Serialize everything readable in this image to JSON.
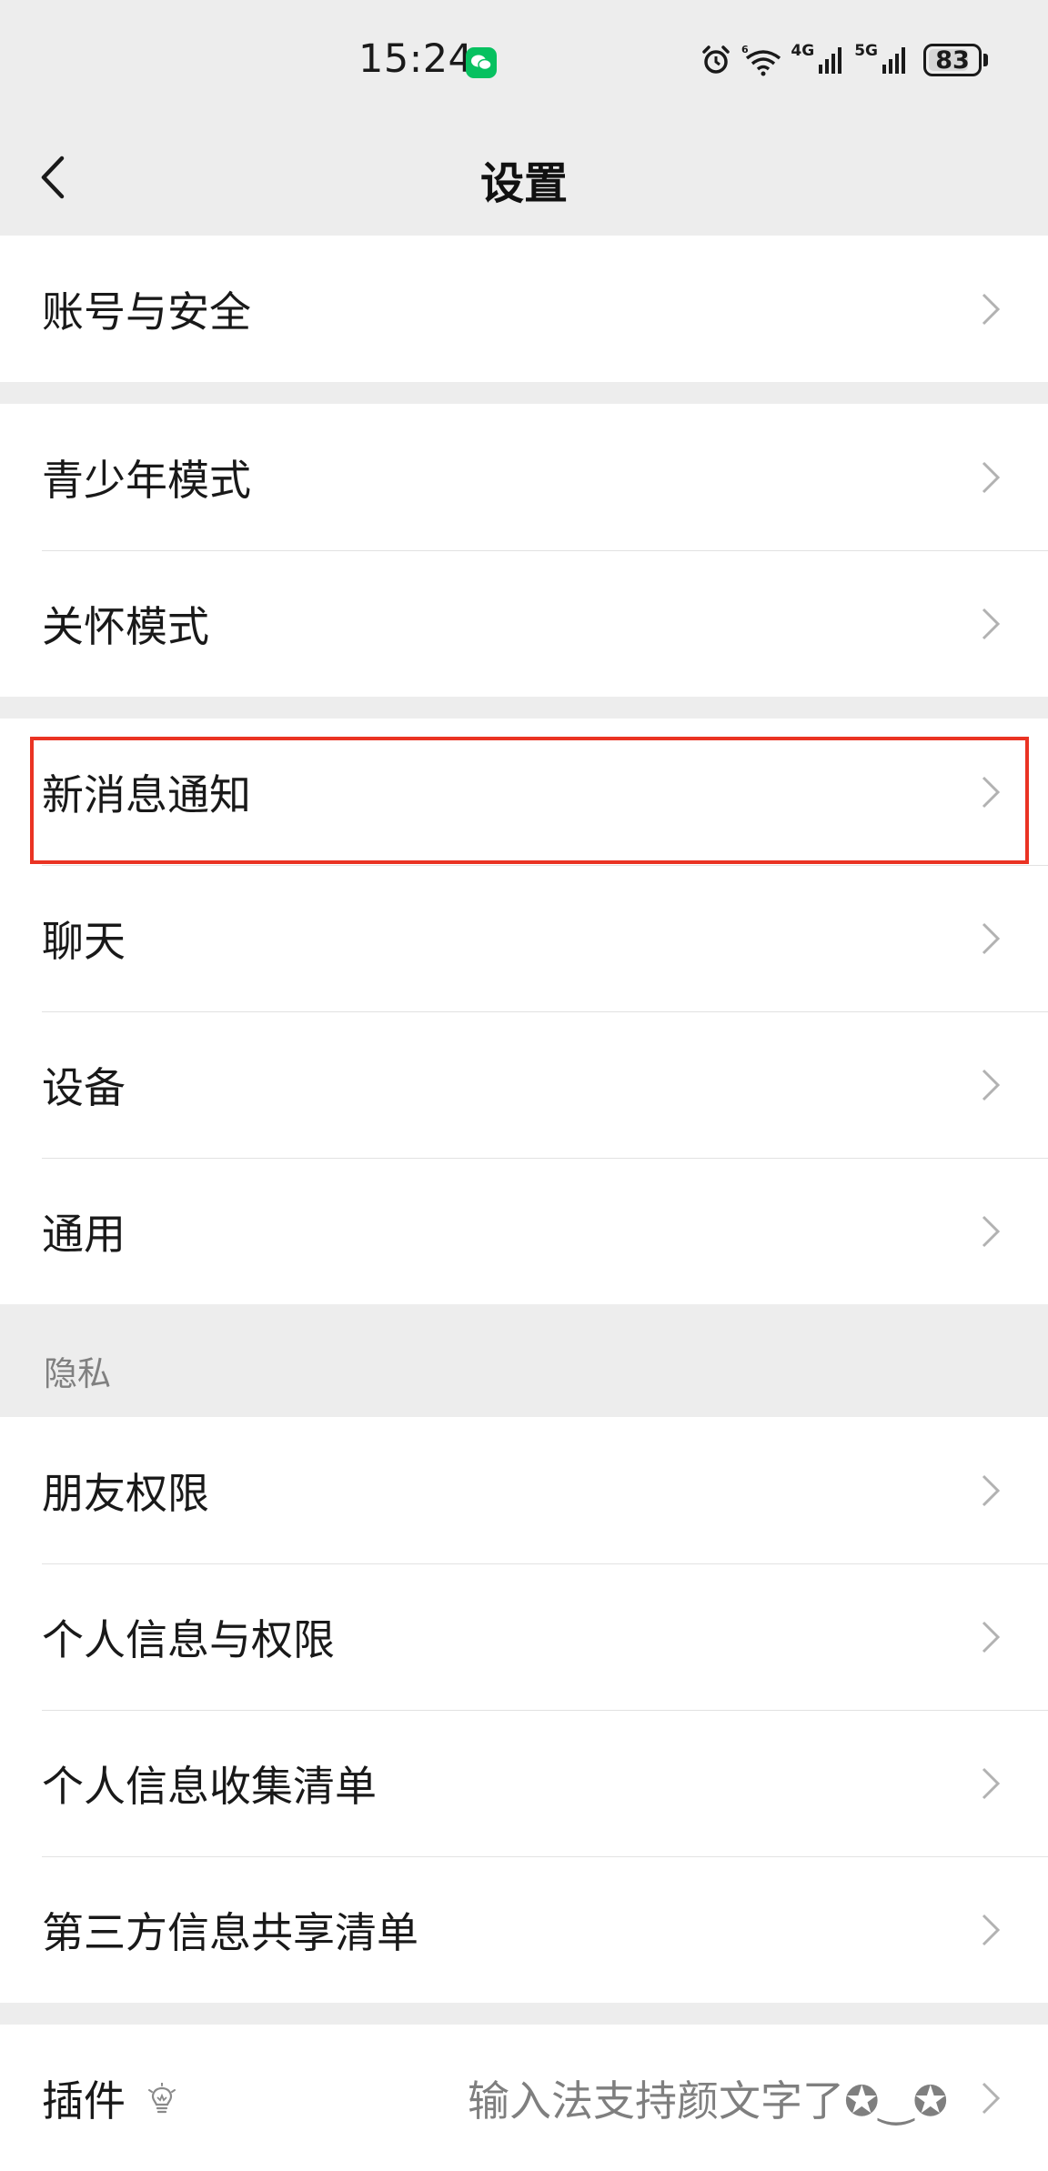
{
  "status_bar": {
    "time": "15:24",
    "network_1": "4G",
    "network_2": "5G",
    "battery": "83",
    "battery_level": 0.83
  },
  "nav": {
    "title": "设置"
  },
  "groups": [
    {
      "items": [
        {
          "label": "账号与安全"
        }
      ]
    },
    {
      "items": [
        {
          "label": "青少年模式"
        },
        {
          "label": "关怀模式"
        }
      ]
    },
    {
      "items": [
        {
          "label": "新消息通知"
        },
        {
          "label": "聊天"
        },
        {
          "label": "设备"
        },
        {
          "label": "通用"
        }
      ]
    },
    {
      "items": [
        {
          "label": "朋友权限"
        },
        {
          "label": "个人信息与权限"
        },
        {
          "label": "个人信息收集清单"
        },
        {
          "label": "第三方信息共享清单"
        }
      ]
    },
    {
      "items": [
        {
          "label": "插件",
          "value": "输入法支持颜文字了✪‿✪"
        }
      ]
    }
  ],
  "section_headers": {
    "privacy": "隐私"
  },
  "colors": {
    "background": "#ededed",
    "card": "#ffffff",
    "highlight": "#ea3323",
    "wechat_green": "#07c160"
  }
}
